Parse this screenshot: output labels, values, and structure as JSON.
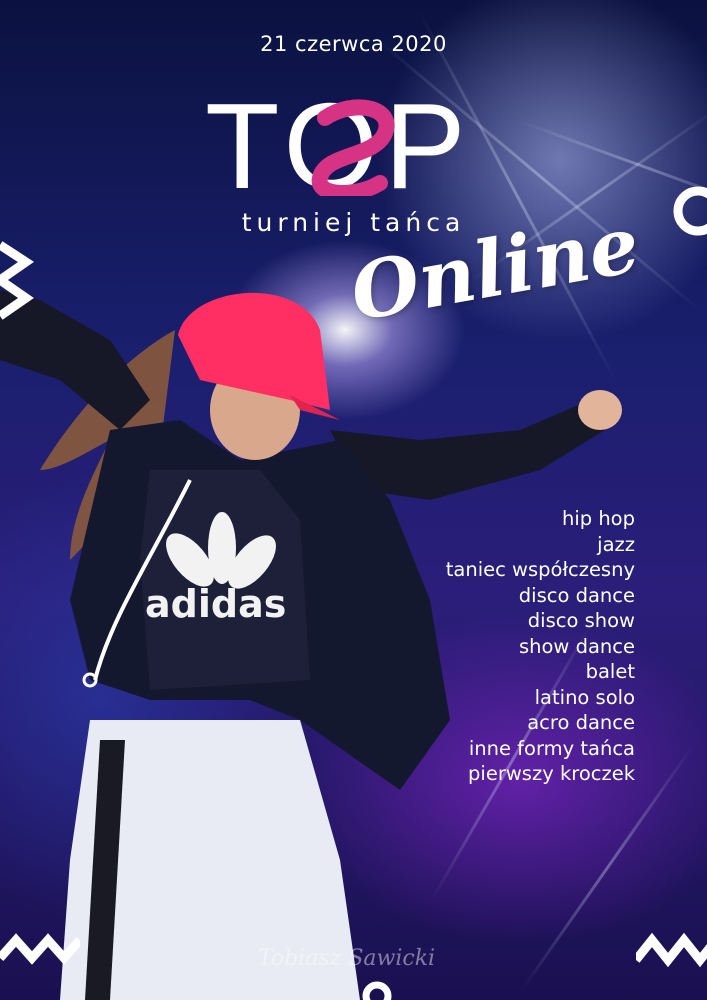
{
  "poster": {
    "date": "21 czerwca 2020",
    "logo_text": "TOP",
    "subtitle": "turniej tańca",
    "online": "Online",
    "styles": [
      "hip hop",
      "jazz",
      "taniec współczesny",
      "disco dance",
      "disco show",
      "show dance",
      "balet",
      "latino solo",
      "acro dance",
      "inne formy tańca",
      "pierwszy kroczek"
    ],
    "photo_credit": "Tobiasz Sawicki",
    "shirt_brand": "adidas"
  },
  "colors": {
    "logo_accent": "#d63384",
    "cap": "#ff2e63",
    "text": "#ffffff"
  }
}
